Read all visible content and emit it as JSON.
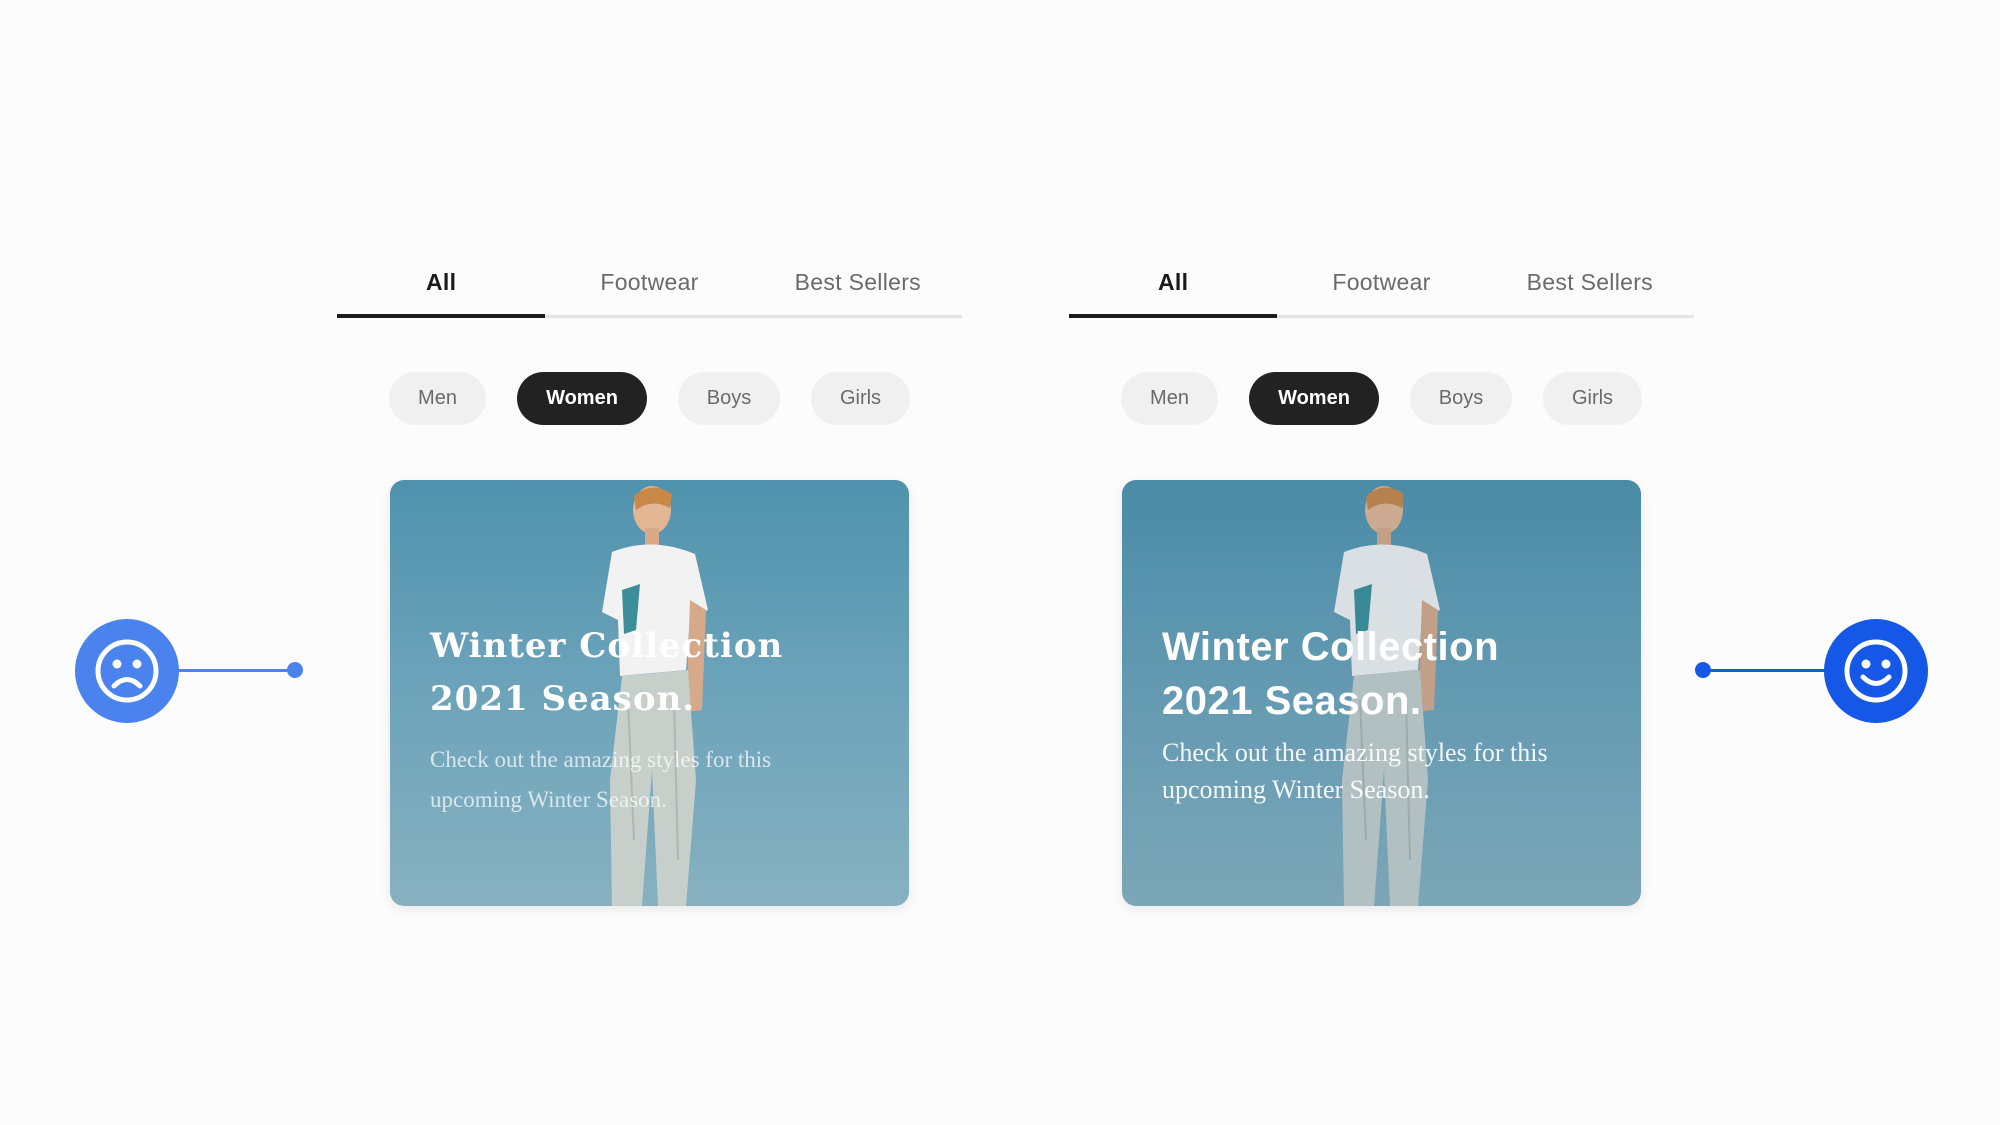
{
  "left_panel": {
    "tabs": [
      "All",
      "Footwear",
      "Best Sellers"
    ],
    "active_tab": "All",
    "chips": [
      "Men",
      "Women",
      "Boys",
      "Girls"
    ],
    "active_chip": "Women",
    "card": {
      "title_line1": "Winter Collection",
      "title_line2": "2021 Season.",
      "desc_line1": "Check out the amazing styles for this",
      "desc_line2": "upcoming Winter Season."
    }
  },
  "right_panel": {
    "tabs": [
      "All",
      "Footwear",
      "Best Sellers"
    ],
    "active_tab": "All",
    "chips": [
      "Men",
      "Women",
      "Boys",
      "Girls"
    ],
    "active_chip": "Women",
    "card": {
      "title_line1": "Winter Collection",
      "title_line2": "2021 Season.",
      "desc_line1": "Check out the amazing styles for this",
      "desc_line2": "upcoming Winter Season."
    }
  },
  "indicators": {
    "left_icon": "sad-face-icon",
    "right_icon": "happy-face-icon"
  },
  "colors": {
    "sad_blue": "#4a83ee",
    "happy_blue": "#1557e6",
    "active_chip": "#222222",
    "card_top": "#4f92ad",
    "card_bottom": "#87b1c0"
  }
}
